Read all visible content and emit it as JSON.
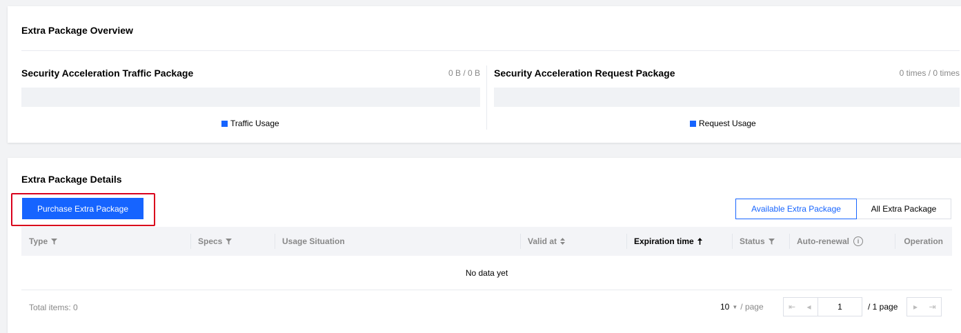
{
  "overview": {
    "title": "Extra Package Overview",
    "traffic": {
      "title": "Security Acceleration Traffic Package",
      "value": "0 B / 0 B",
      "usage": 0,
      "legend": "Traffic Usage"
    },
    "request": {
      "title": "Security Acceleration Request Package",
      "value": "0 times / 0 times",
      "usage": 0,
      "legend": "Request Usage"
    }
  },
  "details": {
    "title": "Extra Package Details",
    "purchase_label": "Purchase Extra Package",
    "tabs": [
      {
        "label": "Available Extra Package",
        "active": true
      },
      {
        "label": "All Extra Package",
        "active": false
      }
    ],
    "columns": [
      {
        "label": "Type",
        "icon": "filter-icon"
      },
      {
        "label": "Specs",
        "icon": "filter-icon"
      },
      {
        "label": "Usage Situation",
        "icon": ""
      },
      {
        "label": "Valid at",
        "icon": "sort-icon"
      },
      {
        "label": "Expiration time",
        "icon": "sort-ascending-icon"
      },
      {
        "label": "Status",
        "icon": "filter-icon"
      },
      {
        "label": "Auto-renewal",
        "icon": "info-icon"
      },
      {
        "label": "Operation",
        "icon": ""
      }
    ],
    "empty_text": "No data yet",
    "total_label": "Total items: 0",
    "pager": {
      "page_size": "10",
      "page_size_unit": "/ page",
      "current_page": "1",
      "total_pages": "/ 1 page"
    }
  },
  "colors": {
    "accent": "#1664ff",
    "highlight": "#d9001b"
  }
}
